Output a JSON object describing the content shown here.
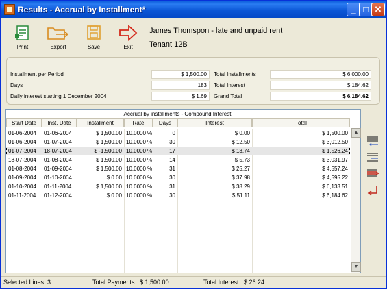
{
  "window": {
    "title": "Results - Accrual by Installment*",
    "minimize": "_",
    "maximize": "□",
    "close": "✕"
  },
  "toolbar": {
    "print": "Print",
    "export": "Export",
    "save": "Save",
    "exit": "Exit"
  },
  "tenant": {
    "name": "James Thomspon - late and unpaid rent",
    "unit": "Tenant 12B"
  },
  "summary": {
    "installment_label": "Installment per Period",
    "installment_value": "$ 1,500.00",
    "days_label": "Days",
    "days_value": "183",
    "daily_interest_label": "Daily interest starting 1 December 2004",
    "daily_interest_value": "$ 1.69",
    "total_installments_label": "Total Installments",
    "total_installments_value": "$ 6,000.00",
    "total_interest_label": "Total Interest",
    "total_interest_value": "$ 184.62",
    "grand_total_label": "Grand Total",
    "grand_total_value": "$ 6,184.62"
  },
  "grid": {
    "caption": "Accrual by installments - Compound Interest",
    "columns": [
      "Start Date",
      "Inst. Date",
      "Installment",
      "Rate",
      "Days",
      "Interest",
      "Total"
    ],
    "rows": [
      [
        "01-06-2004",
        "01-06-2004",
        "$ 1,500.00",
        "10.0000 %",
        "0",
        "$ 0.00",
        "$ 1,500.00"
      ],
      [
        "01-06-2004",
        "01-07-2004",
        "$ 1,500.00",
        "10.0000 %",
        "30",
        "$ 12.50",
        "$ 3,012.50"
      ],
      [
        "01-07-2004",
        "18-07-2004",
        "$ -1,500.00",
        "10.0000 %",
        "17",
        "$ 13.74",
        "$ 1,526.24"
      ],
      [
        "18-07-2004",
        "01-08-2004",
        "$ 1,500.00",
        "10.0000 %",
        "14",
        "$ 5.73",
        "$ 3,031.97"
      ],
      [
        "01-08-2004",
        "01-09-2004",
        "$ 1,500.00",
        "10.0000 %",
        "31",
        "$ 25.27",
        "$ 4,557.24"
      ],
      [
        "01-09-2004",
        "01-10-2004",
        "$ 0.00",
        "10.0000 %",
        "30",
        "$ 37.98",
        "$ 4,595.22"
      ],
      [
        "01-10-2004",
        "01-11-2004",
        "$ 1,500.00",
        "10.0000 %",
        "31",
        "$ 38.29",
        "$ 6,133.51"
      ],
      [
        "01-11-2004",
        "01-12-2004",
        "$ 0.00",
        "10.0000 %",
        "30",
        "$ 51.11",
        "$ 6,184.62"
      ]
    ],
    "selected_row": 2
  },
  "scrollbar": {
    "up": "▲",
    "down": "▼"
  },
  "status": {
    "selected_lines": "Selected Lines: 3",
    "total_payments": "Total Payments : $ 1,500.00",
    "total_interest": "Total Interest : $ 26.24"
  },
  "side_icons": [
    "add-line-icon",
    "insert-line-icon",
    "delete-line-icon",
    "undo-icon"
  ],
  "colors": {
    "titlebar": "#0a5bd8",
    "exit_arrow": "#d42a1c",
    "print_icon": "#2a8a3a",
    "export_icon": "#d98c20",
    "save_icon": "#e0a030"
  }
}
